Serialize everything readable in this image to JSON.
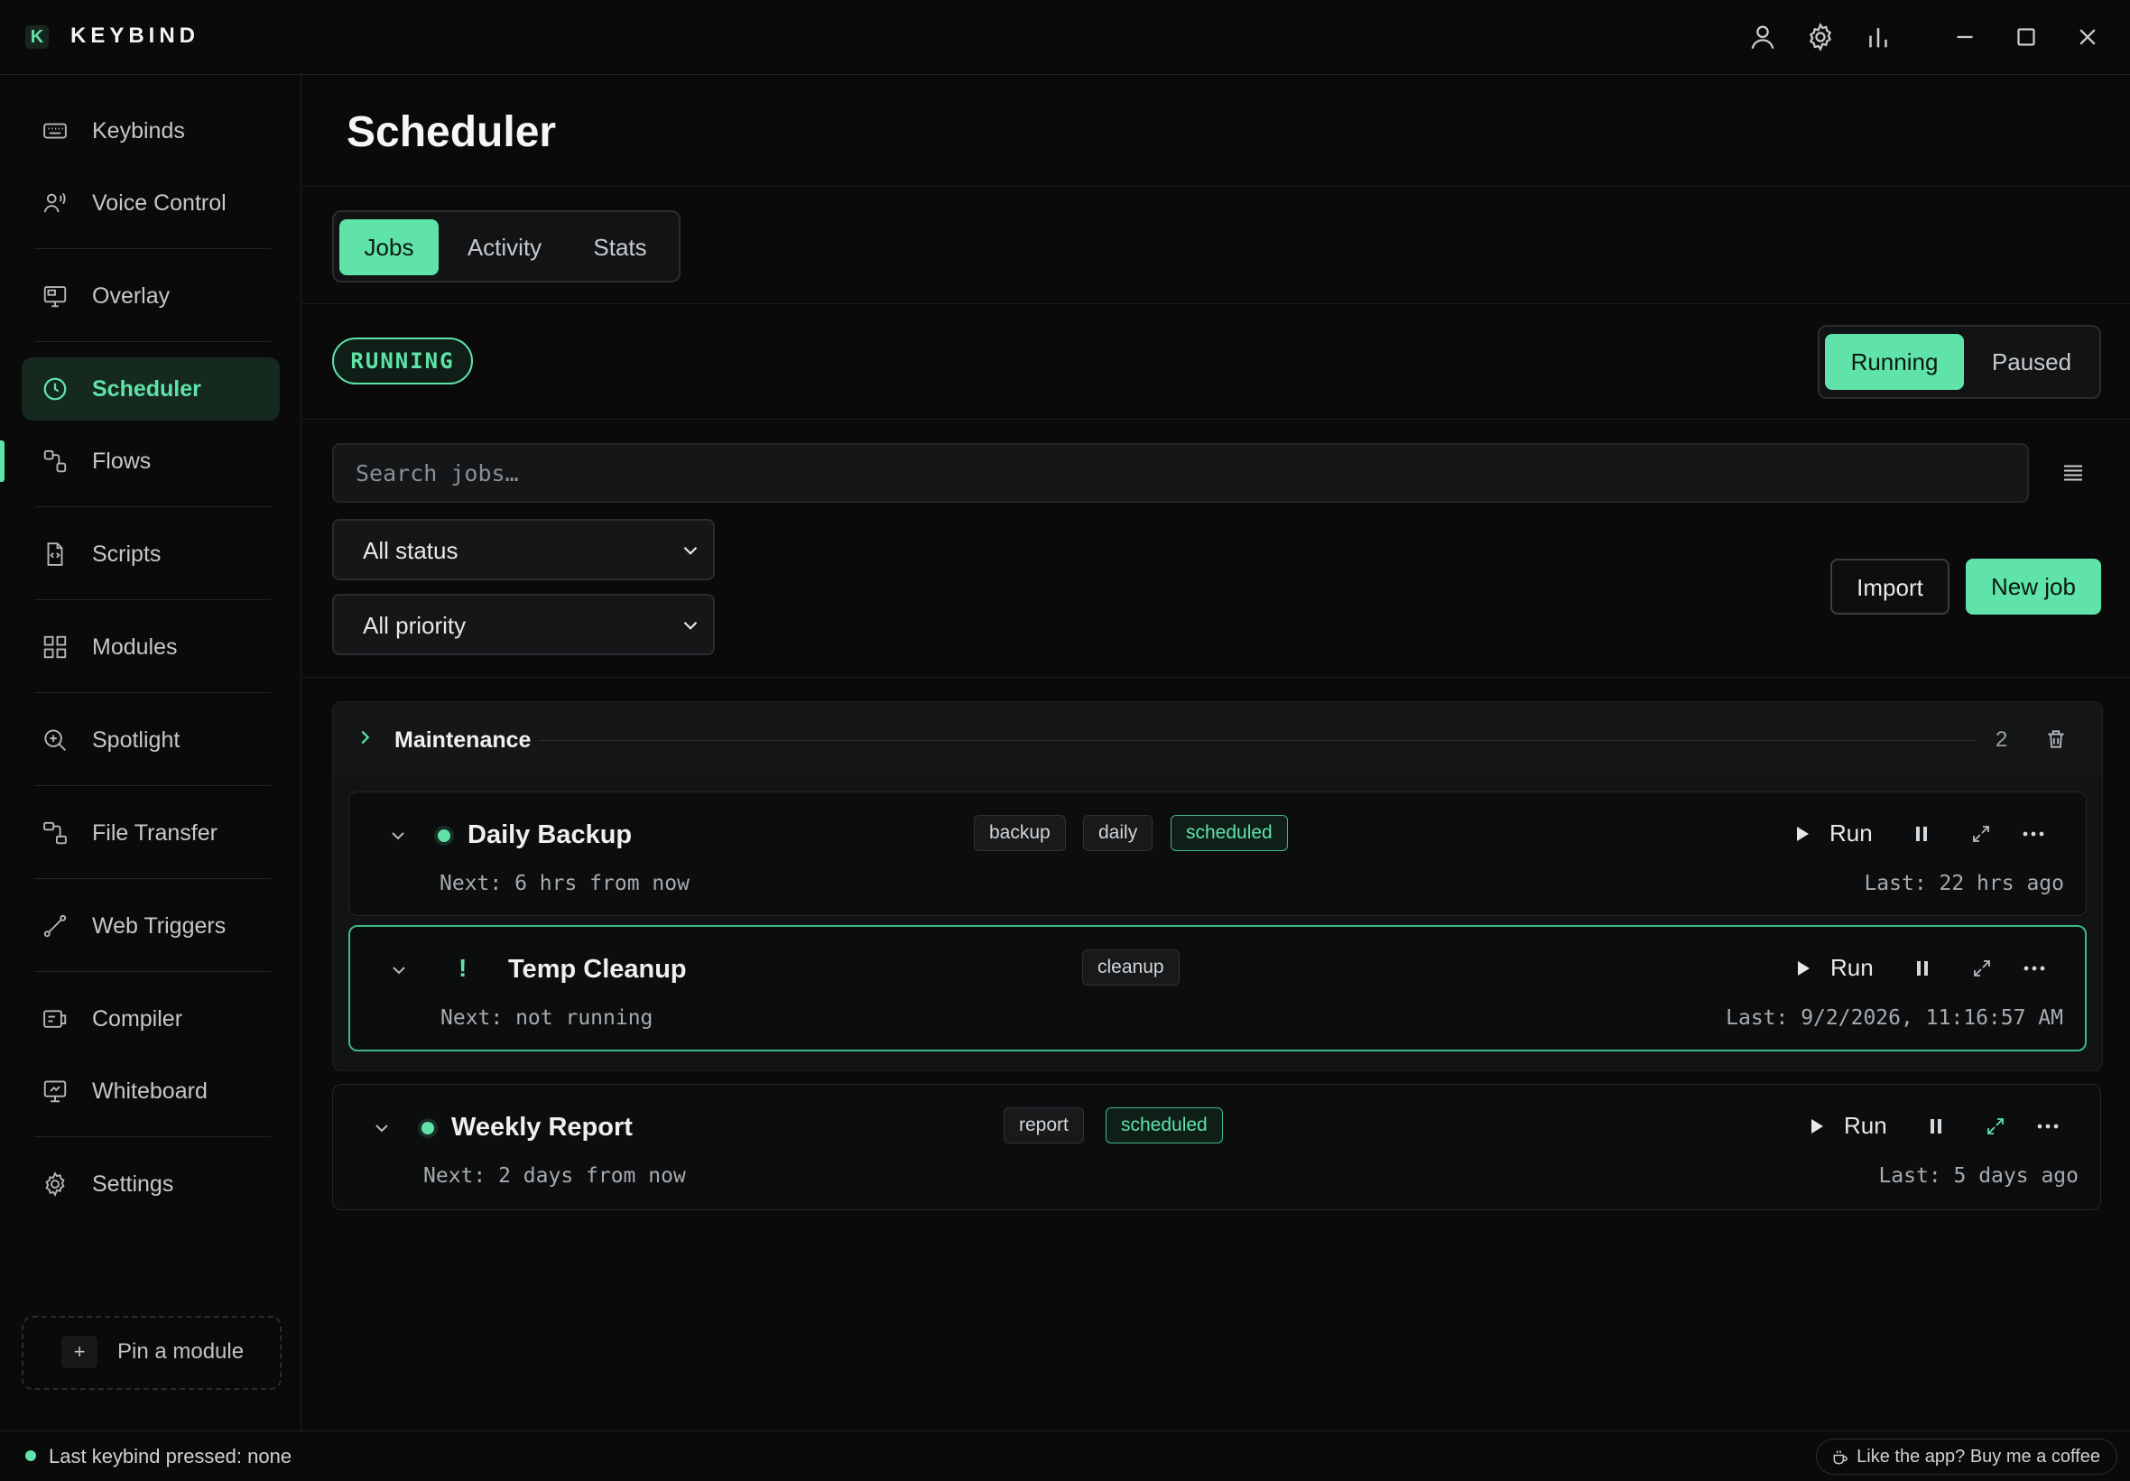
{
  "app": {
    "brand": "KEYBIND",
    "logo_letter": "K",
    "accent": "#5fe3a8"
  },
  "sidebar": {
    "items": [
      {
        "label": "Keybinds",
        "icon": "keyboard-icon"
      },
      {
        "label": "Voice Control",
        "icon": "voice-icon"
      },
      {
        "label": "Overlay",
        "icon": "monitor-icon"
      },
      {
        "label": "Scheduler",
        "icon": "clock-icon",
        "active": true
      },
      {
        "label": "Flows",
        "icon": "flow-icon"
      },
      {
        "label": "Scripts",
        "icon": "script-file-icon"
      },
      {
        "label": "Modules",
        "icon": "grid-icon"
      },
      {
        "label": "Spotlight",
        "icon": "search-zoom-icon"
      },
      {
        "label": "File Transfer",
        "icon": "file-transfer-icon"
      },
      {
        "label": "Web Triggers",
        "icon": "webhook-icon"
      },
      {
        "label": "Compiler",
        "icon": "compiler-icon"
      },
      {
        "label": "Whiteboard",
        "icon": "whiteboard-icon"
      },
      {
        "label": "Settings",
        "icon": "gear-icon"
      }
    ],
    "pin_label": "Pin a module",
    "pin_plus": "+"
  },
  "main": {
    "title": "Scheduler",
    "tabs": [
      "Jobs",
      "Activity",
      "Stats"
    ],
    "active_tab": "Jobs",
    "status_badge": "RUNNING",
    "mode_toggle": [
      "Running",
      "Paused"
    ],
    "active_mode": "Running",
    "search_placeholder": "Search jobs…",
    "filters": {
      "status": "All status",
      "priority": "All priority"
    },
    "import_label": "Import",
    "new_job_label": "New job"
  },
  "groups": [
    {
      "name": "Maintenance",
      "count": "2",
      "jobs": [
        {
          "name": "Daily Backup",
          "tags": [
            "backup",
            "daily",
            "scheduled"
          ],
          "next": "Next: 6 hrs from now",
          "last": "Last: 22 hrs ago",
          "run": "Run",
          "status": "active"
        },
        {
          "name": "Temp Cleanup",
          "tags": [
            "cleanup"
          ],
          "next": "Next: not running",
          "last": "Last: 9/2/2026, 11:16:57 AM",
          "run": "Run",
          "status": "warning",
          "warn_glyph": "!"
        }
      ]
    }
  ],
  "ungrouped_jobs": [
    {
      "name": "Weekly Report",
      "tags": [
        "report",
        "scheduled"
      ],
      "next": "Next: 2 days from now",
      "last": "Last: 5 days ago",
      "run": "Run",
      "status": "active"
    }
  ],
  "statusbar": {
    "last_keybind": "Last keybind pressed: none",
    "coffee": "Like the app? Buy me a coffee"
  }
}
